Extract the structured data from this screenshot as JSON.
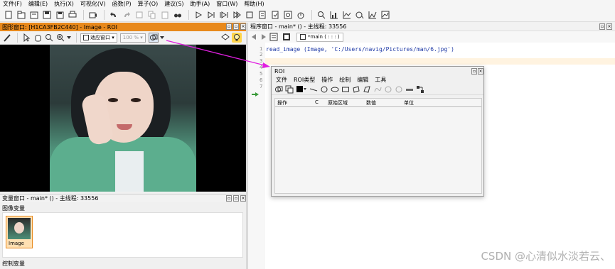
{
  "menu": [
    "文件(F)",
    "编辑(E)",
    "执行(X)",
    "可视化(V)",
    "函数(P)",
    "算子(O)",
    "建议(S)",
    "助手(A)",
    "窗口(W)",
    "帮助(H)"
  ],
  "graphics_window": {
    "title": "图形窗口: [H1CA3FB2C440] - Image - ROI",
    "zoom_combo": "适应窗口",
    "zoom_percent": "100 %"
  },
  "variable_window": {
    "title": "变量窗口 - main* () - 主线程: 33556",
    "image_section": "图像变量",
    "image_name": "Image",
    "control_section": "控制变量"
  },
  "program_window": {
    "title": "程序窗口 - main* () - 主线程: 33556",
    "tab": "*main ( : : : )",
    "line_numbers": [
      "1",
      "2",
      "3",
      "4",
      "5",
      "6",
      "7"
    ],
    "code_line1": "read_image (Image, 'C:/Users/navig/Pictures/man/6.jpg')"
  },
  "roi_dialog": {
    "title": "ROI",
    "menu": [
      "文件",
      "ROI类型",
      "操作",
      "绘制",
      "编辑",
      "工具"
    ],
    "columns": [
      "操作",
      "C",
      "原始区域",
      "数值",
      "单位"
    ]
  },
  "watermark": "CSDN @心清似水淡若云、",
  "colors": {
    "accent": "#e8891c",
    "code": "#1f3aa6",
    "pointer": "#e020e0"
  }
}
